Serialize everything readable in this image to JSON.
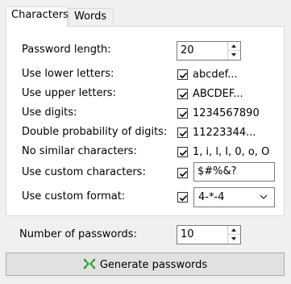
{
  "tabs": [
    "Characters",
    "Words"
  ],
  "options": {
    "password_length": {
      "label": "Password length:",
      "value": "20"
    },
    "lower": {
      "label": "Use lower letters:",
      "checked": true,
      "sample": "abcdef..."
    },
    "upper": {
      "label": "Use upper letters:",
      "checked": true,
      "sample": "ABCDEF..."
    },
    "digits": {
      "label": "Use digits:",
      "checked": true,
      "sample": "1234567890"
    },
    "double_digits": {
      "label": "Double probability of digits:",
      "checked": true,
      "sample": "11223344..."
    },
    "no_similar": {
      "label": "No similar characters:",
      "checked": true,
      "sample": "1, i, l, I, 0, o, O"
    },
    "custom_chars": {
      "label": "Use custom characters:",
      "checked": true,
      "value": "$#%&?"
    },
    "custom_format": {
      "label": "Use custom format:",
      "checked": true,
      "value": "4-*-4"
    }
  },
  "number_of_passwords": {
    "label": "Number of passwords:",
    "value": "10"
  },
  "generate_button": {
    "label": "Generate passwords"
  },
  "colors": {
    "icon_green": "#2e8b2e",
    "icon_accent": "#7fd37f"
  }
}
